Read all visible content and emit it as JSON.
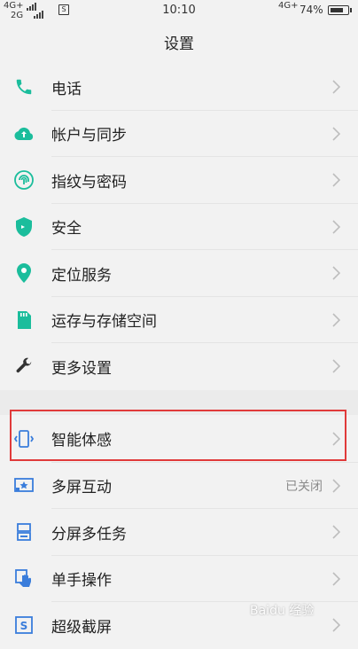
{
  "status_bar": {
    "net_top_left": "4G+",
    "net_bottom_left": "2G",
    "sim_icon": "S",
    "time": "10:10",
    "net_right": "4G+",
    "battery": "74%"
  },
  "header": {
    "title": "设置"
  },
  "menu_group1": [
    {
      "label": "电话",
      "icon": "phone-icon"
    },
    {
      "label": "帐户与同步",
      "icon": "cloud-sync-icon"
    },
    {
      "label": "指纹与密码",
      "icon": "fingerprint-icon"
    },
    {
      "label": "安全",
      "icon": "shield-icon"
    },
    {
      "label": "定位服务",
      "icon": "location-icon"
    },
    {
      "label": "运存与存储空间",
      "icon": "storage-card-icon"
    },
    {
      "label": "更多设置",
      "icon": "wrench-icon"
    }
  ],
  "menu_group2": [
    {
      "label": "智能体感",
      "icon": "motion-sense-icon"
    },
    {
      "label": "多屏互动",
      "icon": "multi-screen-icon",
      "status": "已关闭"
    },
    {
      "label": "分屏多任务",
      "icon": "split-screen-icon"
    },
    {
      "label": "单手操作",
      "icon": "one-hand-icon"
    },
    {
      "label": "超级截屏",
      "icon": "screenshot-icon"
    }
  ],
  "colors": {
    "accent_teal": "#1bbd9c",
    "accent_blue": "#3a7ddb",
    "highlight": "#e03a3a"
  },
  "watermark": "Baidu 经验"
}
